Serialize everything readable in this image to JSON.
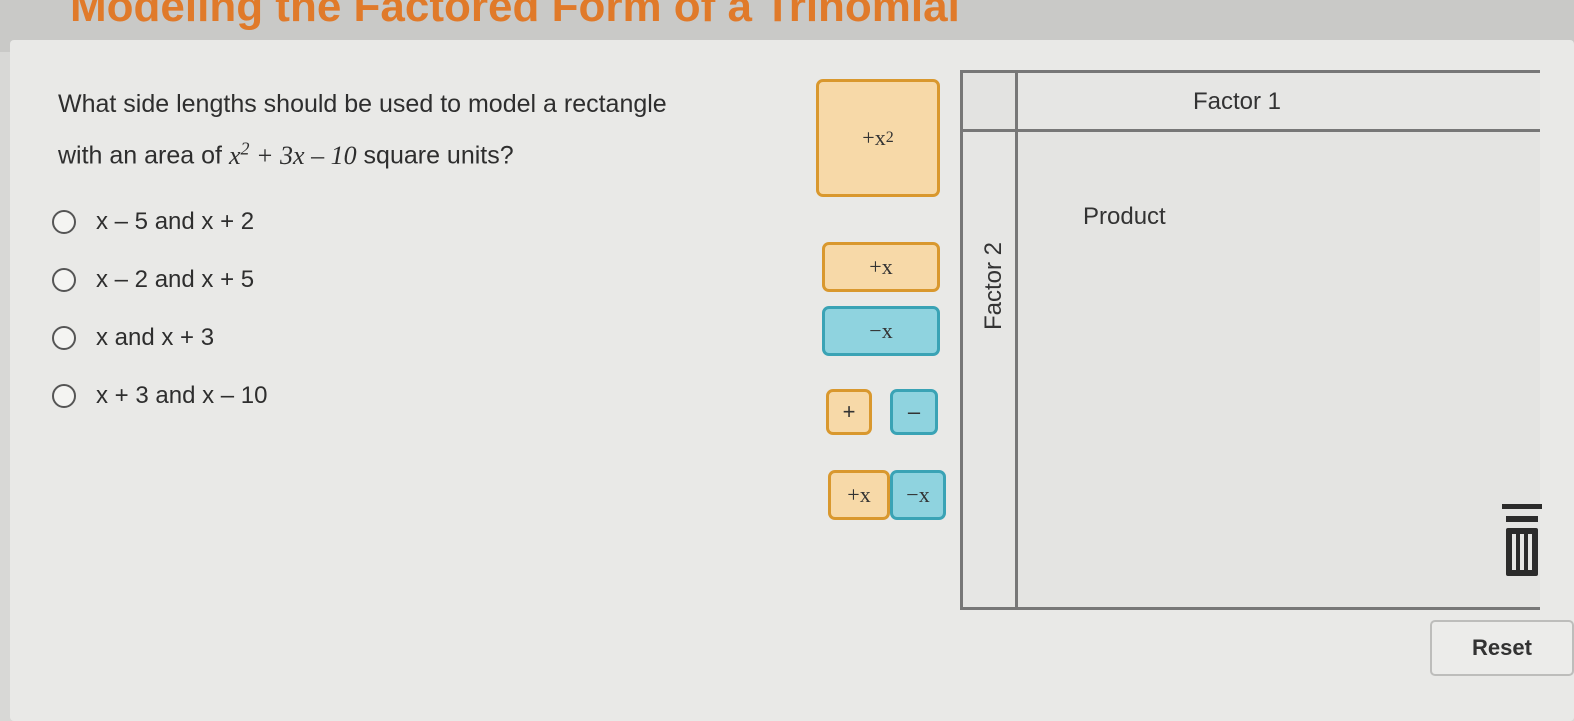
{
  "header": {
    "title": "Modeling the Factored Form of a Trinomial"
  },
  "question": {
    "line1": "What side lengths should be used to model a rectangle",
    "prefix": "with an area of",
    "area_x": "x",
    "area_exp": "2",
    "area_rest": " + 3x – 10",
    "suffix": "square units?"
  },
  "options": [
    {
      "label": "x – 5 and x + 2"
    },
    {
      "label": "x – 2 and x + 5"
    },
    {
      "label": "x and x + 3"
    },
    {
      "label": "x + 3 and x – 10"
    }
  ],
  "tiles": {
    "x2": {
      "base": "+x",
      "exp": "2"
    },
    "pos_x": "+x",
    "neg_x": "−x",
    "pos_one": "+",
    "neg_one": "–",
    "combo_pos": "+x",
    "combo_neg": "−x"
  },
  "grid": {
    "factor1": "Factor 1",
    "factor2": "Factor 2",
    "product": "Product"
  },
  "reset_label": "Reset",
  "colors": {
    "title_orange": "#e07a2a",
    "positive_tile": "#f7d9a8",
    "positive_border": "#d9982e",
    "negative_tile": "#8fd3df",
    "negative_border": "#3aa3b5"
  },
  "icons": {
    "trash": "trash-icon"
  }
}
